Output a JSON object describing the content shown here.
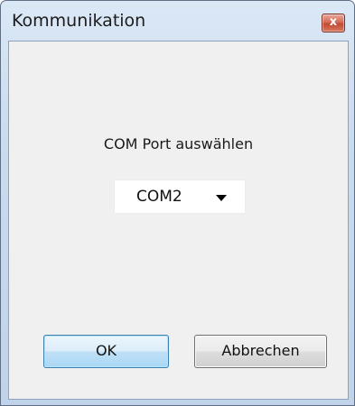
{
  "window": {
    "title": "Kommunikation",
    "close_glyph": "x"
  },
  "dialog": {
    "prompt": "COM Port auswählen",
    "port_select": {
      "selected": "COM2"
    },
    "buttons": {
      "ok_label": "OK",
      "cancel_label": "Abbrechen"
    }
  },
  "icons": {
    "close": "close-icon",
    "dropdown": "chevron-down-icon"
  },
  "colors": {
    "ok_button_accent": "#a9d7f5",
    "close_button": "#c24a33"
  }
}
